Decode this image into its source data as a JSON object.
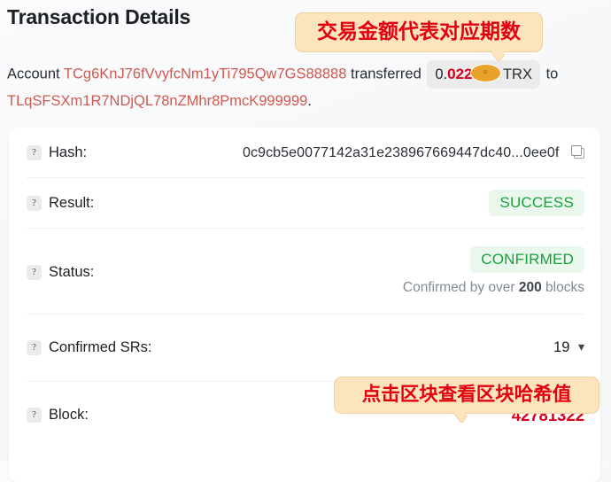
{
  "page": {
    "title": "Transaction Details"
  },
  "summary": {
    "account_label": "Account",
    "from_address": "TCg6KnJ76fVvyfcNm1yTi795Qw7GS88888",
    "transferred_label": "transferred",
    "amount_integer": "0.",
    "amount_decimals": "0226",
    "token_symbol": "TRX",
    "token_icon": "tron-logo-icon",
    "to_label": "to",
    "to_address": "TLqSFSXm1R7NDjQL78nZMhr8PmcK999999",
    "period": "."
  },
  "callouts": {
    "amount": "交易金额代表对应期数",
    "block": "点击区块查看区块哈希值"
  },
  "details": {
    "hash": {
      "label": "Hash:",
      "value": "0c9cb5e0077142a31e238967669447dc40...0ee0f",
      "copy_icon": "copy-icon",
      "help_icon": "question-mark-icon"
    },
    "result": {
      "label": "Result:",
      "badge": "SUCCESS",
      "help_icon": "question-mark-icon"
    },
    "status": {
      "label": "Status:",
      "badge": "CONFIRMED",
      "note_prefix": "Confirmed by over ",
      "note_count": "200",
      "note_suffix": " blocks",
      "help_icon": "question-mark-icon"
    },
    "confirmed_srs": {
      "label": "Confirmed SRs:",
      "value": "19",
      "chevron_icon": "chevron-down-icon",
      "help_icon": "question-mark-icon"
    },
    "block": {
      "label": "Block:",
      "value": "42781322",
      "help_icon": "question-mark-icon"
    }
  },
  "colors": {
    "accent_red": "#d8001d",
    "address_red": "#d0594f",
    "success_green": "#18a03c",
    "callout_bg": "#fce4bc"
  }
}
